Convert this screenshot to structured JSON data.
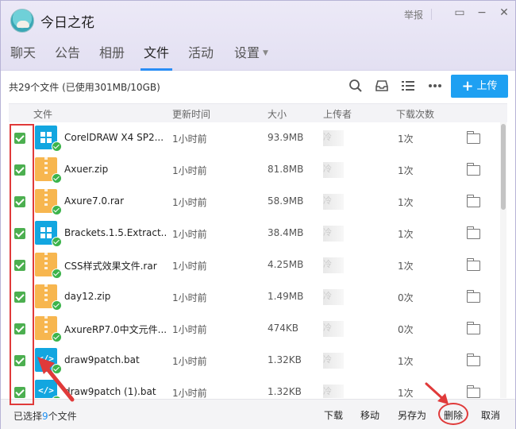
{
  "app": {
    "title": "今日之花",
    "report": "举报"
  },
  "window_controls": {
    "minimize": "▭",
    "maximize": "−",
    "close": "✕"
  },
  "tabs": [
    {
      "label": "聊天"
    },
    {
      "label": "公告"
    },
    {
      "label": "相册"
    },
    {
      "label": "文件",
      "active": true
    },
    {
      "label": "活动"
    },
    {
      "label": "设置",
      "caret": "▼"
    }
  ],
  "toolbar": {
    "count_text": "共29个文件 (已使用301MB/10GB)",
    "upload_label": "上传",
    "upload_plus": "+"
  },
  "columns": [
    "文件",
    "更新时间",
    "大小",
    "上传者",
    "下载次数"
  ],
  "files": [
    {
      "name": "CorelDRAW X4 SP2...",
      "time": "1小时前",
      "size": "93.9MB",
      "uploader": "冷",
      "downloads": "1次",
      "icon": "windows-icon"
    },
    {
      "name": "Axuer.zip",
      "time": "1小时前",
      "size": "81.8MB",
      "uploader": "冷",
      "downloads": "1次",
      "icon": "zip-icon"
    },
    {
      "name": "Axure7.0.rar",
      "time": "1小时前",
      "size": "58.9MB",
      "uploader": "冷",
      "downloads": "1次",
      "icon": "zip-icon"
    },
    {
      "name": "Brackets.1.5.Extract...",
      "time": "1小时前",
      "size": "38.4MB",
      "uploader": "冷",
      "downloads": "1次",
      "icon": "windows-icon"
    },
    {
      "name": "CSS样式效果文件.rar",
      "time": "1小时前",
      "size": "4.25MB",
      "uploader": "冷",
      "downloads": "1次",
      "icon": "zip-icon"
    },
    {
      "name": "day12.zip",
      "time": "1小时前",
      "size": "1.49MB",
      "uploader": "冷",
      "downloads": "0次",
      "icon": "zip-icon"
    },
    {
      "name": "AxureRP7.0中文元件...",
      "time": "1小时前",
      "size": "474KB",
      "uploader": "冷",
      "downloads": "0次",
      "icon": "zip-icon"
    },
    {
      "name": "draw9patch.bat",
      "time": "1小时前",
      "size": "1.32KB",
      "uploader": "冷",
      "downloads": "1次",
      "icon": "code-icon"
    },
    {
      "name": "draw9patch (1).bat",
      "time": "1小时前",
      "size": "1.32KB",
      "uploader": "冷",
      "downloads": "1次",
      "icon": "code-icon"
    }
  ],
  "code_glyph": "</>",
  "footer": {
    "selected_prefix": "已选择",
    "selected_count": "9",
    "selected_suffix": "个文件",
    "download": "下载",
    "move": "移动",
    "save_as": "另存为",
    "delete": "删除",
    "cancel": "取消"
  },
  "colors": {
    "accent": "#1ea0f2",
    "checkbox": "#4caf50",
    "annotation": "#e03a3a"
  }
}
